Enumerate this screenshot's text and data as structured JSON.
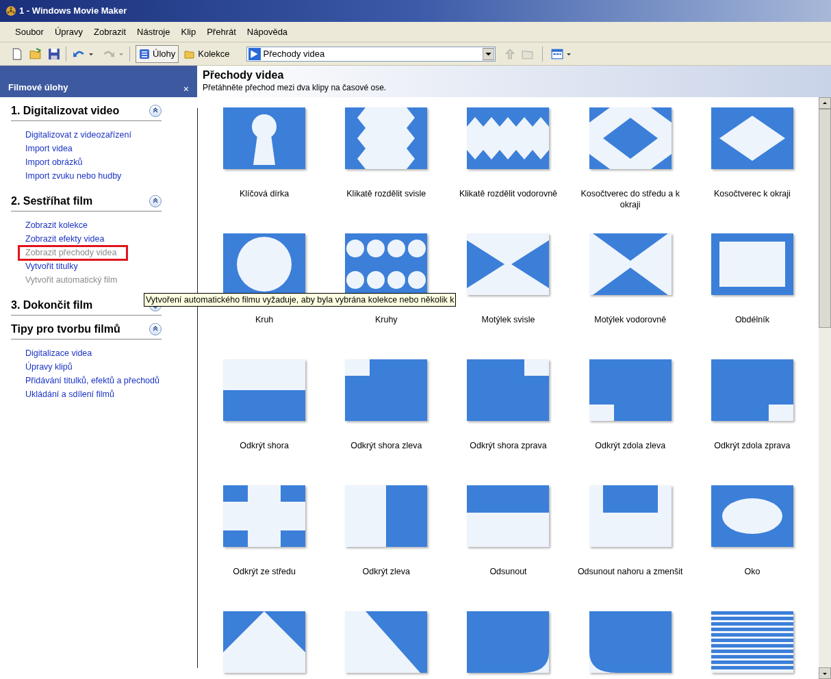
{
  "window": {
    "title": "1 - Windows Movie Maker"
  },
  "menu": [
    "Soubor",
    "Úpravy",
    "Zobrazit",
    "Nástroje",
    "Klip",
    "Přehrát",
    "Nápověda"
  ],
  "toolbar": {
    "tasks": {
      "label": "Úlohy",
      "selected": true
    },
    "collections": {
      "label": "Kolekce",
      "selected": false
    },
    "combo_value": "Přechody videa",
    "redo_disabled": true
  },
  "task_pane": {
    "title": "Filmové úlohy",
    "close": "×",
    "sections": [
      {
        "title": "1. Digitalizovat video",
        "expanded": true,
        "links": [
          {
            "label": "Digitalizovat z videozařízení",
            "disabled": false,
            "highlighted": false
          },
          {
            "label": "Import videa",
            "disabled": false,
            "highlighted": false
          },
          {
            "label": "Import obrázků",
            "disabled": false,
            "highlighted": false
          },
          {
            "label": "Import zvuku nebo hudby",
            "disabled": false,
            "highlighted": false
          }
        ]
      },
      {
        "title": "2. Sestříhat film",
        "expanded": true,
        "links": [
          {
            "label": "Zobrazit kolekce",
            "disabled": false,
            "highlighted": false
          },
          {
            "label": "Zobrazit efekty videa",
            "disabled": false,
            "highlighted": false
          },
          {
            "label": "Zobrazit přechody videa",
            "disabled": true,
            "highlighted": true
          },
          {
            "label": "Vytvořit titulky",
            "disabled": false,
            "highlighted": false
          },
          {
            "label": "Vytvořit automatický film",
            "disabled": true,
            "highlighted": false
          }
        ]
      },
      {
        "title": "3. Dokončit film",
        "expanded": false
      },
      {
        "title": "Tipy pro tvorbu filmů",
        "expanded": true,
        "links": [
          {
            "label": "Digitalizace videa",
            "disabled": false,
            "highlighted": false
          },
          {
            "label": "Úpravy klipů",
            "disabled": false,
            "highlighted": false
          },
          {
            "label": "Přidávání titulků, efektů a přechodů",
            "disabled": false,
            "highlighted": false
          },
          {
            "label": "Ukládání a sdílení filmů",
            "disabled": false,
            "highlighted": false
          }
        ]
      }
    ]
  },
  "content": {
    "title": "Přechody videa",
    "subtitle": "Přetáhněte přechod mezi dva klipy na časové ose.",
    "items": [
      {
        "kind": "keyhole",
        "label": "Klíčová dírka"
      },
      {
        "kind": "zigzag-v",
        "label": "Klikatě rozdělit svisle"
      },
      {
        "kind": "zigzag-h",
        "label": "Klikatě rozdělit vodorovně"
      },
      {
        "kind": "diamond-in",
        "label": "Kosočtverec do středu a k okraji"
      },
      {
        "kind": "diamond-out",
        "label": "Kosočtverec k okraji"
      },
      {
        "kind": "circle",
        "label": "Kruh"
      },
      {
        "kind": "circles",
        "label": "Kruhy"
      },
      {
        "kind": "bowtie-v",
        "label": "Motýlek svisle"
      },
      {
        "kind": "bowtie-h",
        "label": "Motýlek vodorovně"
      },
      {
        "kind": "rectangle",
        "label": "Obdélník"
      },
      {
        "kind": "reveal-top",
        "label": "Odkrýt shora"
      },
      {
        "kind": "reveal-tl",
        "label": "Odkrýt shora zleva"
      },
      {
        "kind": "reveal-tr",
        "label": "Odkrýt shora zprava"
      },
      {
        "kind": "reveal-bl",
        "label": "Odkrýt zdola zleva"
      },
      {
        "kind": "reveal-br",
        "label": "Odkrýt zdola zprava"
      },
      {
        "kind": "reveal-center",
        "label": "Odkrýt ze středu"
      },
      {
        "kind": "reveal-left",
        "label": "Odkrýt zleva"
      },
      {
        "kind": "push",
        "label": "Odsunout"
      },
      {
        "kind": "push-shrink",
        "label": "Odsunout nahoru a zmenšit"
      },
      {
        "kind": "eye",
        "label": "Oko"
      },
      {
        "kind": "chevron"
      },
      {
        "kind": "diagonal"
      },
      {
        "kind": "corner-br"
      },
      {
        "kind": "corner-bl"
      },
      {
        "kind": "stripes"
      }
    ]
  },
  "tooltip": "Vytvoření automatického filmu vyžaduje, aby byla vybrána kolekce nebo několik k"
}
